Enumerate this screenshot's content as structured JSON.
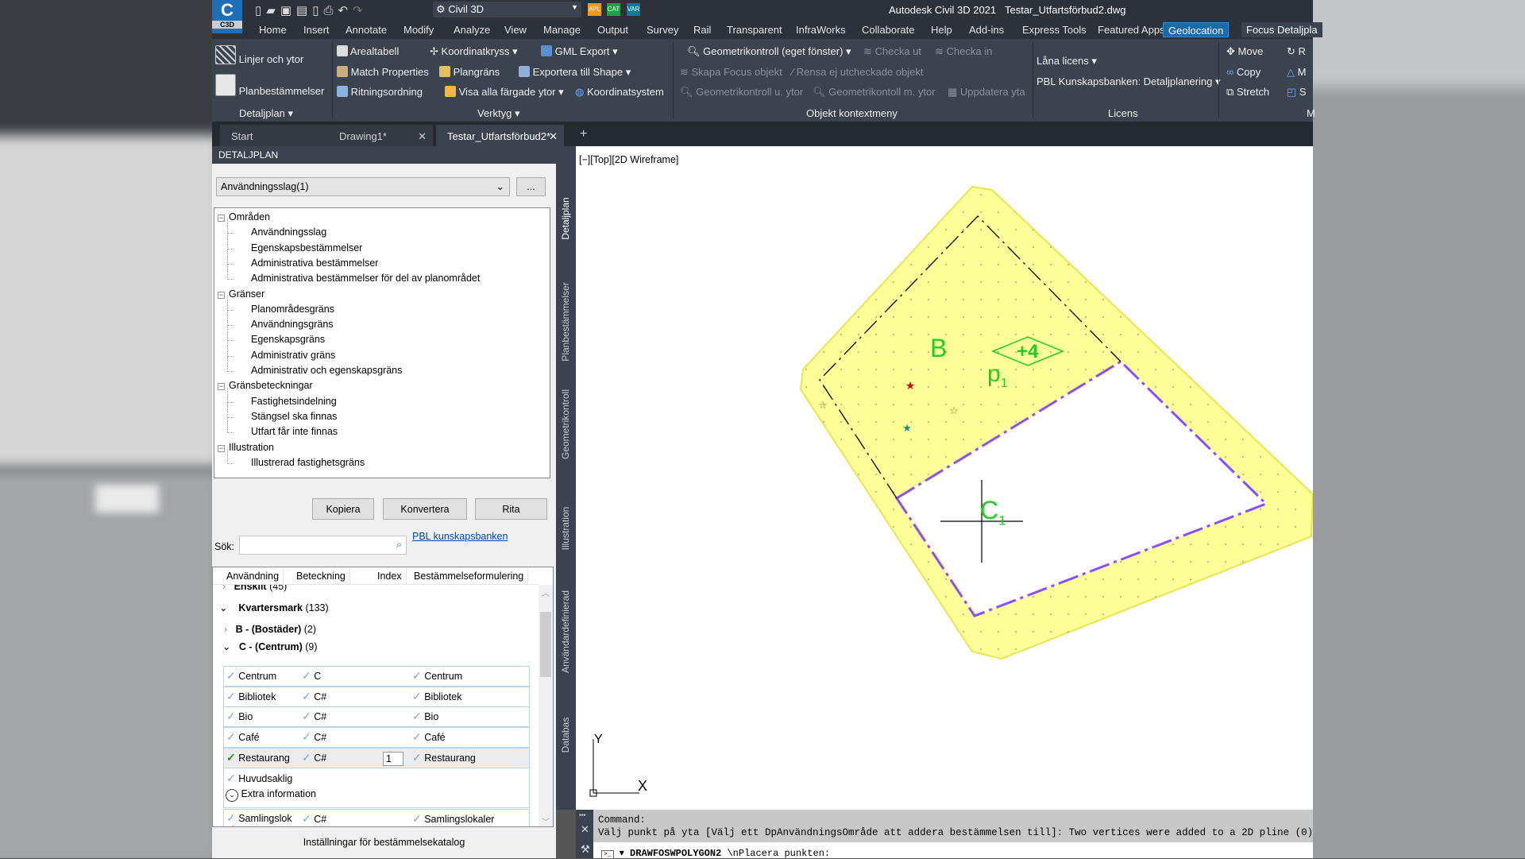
{
  "titlebar": {
    "app_title": "Autodesk Civil 3D 2021",
    "file": "Testar_Utfartsförbud2.dwg",
    "workspace": "Civil 3D",
    "app_badge": "C3D",
    "quick_badges": [
      "APL",
      "CAT",
      "VAR"
    ]
  },
  "menu_tabs": [
    "Home",
    "Insert",
    "Annotate",
    "Modify",
    "Analyze",
    "View",
    "Manage",
    "Output",
    "Survey",
    "Rail",
    "Transparent",
    "InfraWorks",
    "Collaborate",
    "Help",
    "Add-ins",
    "Express Tools",
    "Featured Apps",
    "Geolocation",
    "Focus Detaljpla"
  ],
  "ribbon": {
    "detaljplan": {
      "items": [
        "Linjer och ytor",
        "Planbestämmelser"
      ],
      "label": "Detaljplan"
    },
    "verktyg": {
      "items": [
        "Arealtabell",
        "Koordinatkryss",
        "GML Export",
        "Match Properties",
        "Plangräns",
        "Exportera till Shape",
        "Ritningsordning",
        "Visa alla färgade ytor",
        "Koordinatsystem"
      ],
      "label": "Verktyg"
    },
    "objekt": {
      "items": [
        "Geometrikontroll (eget fönster)",
        "Checka ut",
        "Checka in",
        "Skapa Focus objekt",
        "Rensa ej utcheckade objekt",
        "Geometrikontroll u. ytor",
        "Geometrikontoll m. ytor",
        "Uppdatera yta"
      ],
      "label": "Objekt kontextmeny"
    },
    "licens": {
      "items": [
        "Låna licens",
        "PBL Kunskapsbanken: Detaljplanering"
      ],
      "label": "Licens"
    },
    "modify": {
      "items": [
        "Move",
        "Copy",
        "Stretch",
        "R",
        "M",
        "S"
      ],
      "label": "M"
    }
  },
  "doc_tabs": [
    {
      "label": "Start"
    },
    {
      "label": "Drawing1*"
    },
    {
      "label": "Testar_Utfartsförbud2*"
    }
  ],
  "panel": {
    "header": "DETALJPLAN",
    "dropdown_value": "Användningsslag(1)",
    "more_button": "...",
    "tree": [
      {
        "label": "Områden",
        "children": [
          "Användningsslag",
          "Egenskapsbestämmelser",
          "Administrativa bestämmelser",
          "Administrativa bestämmelser för del av planområdet"
        ]
      },
      {
        "label": "Gränser",
        "children": [
          "Planområdesgräns",
          "Användningsgräns",
          "Egenskapsgräns",
          "Administrativ gräns",
          "Administrativ och egenskapsgräns"
        ]
      },
      {
        "label": "Gränsbeteckningar",
        "children": [
          "Fastighetsindelning",
          "Stängsel ska finnas",
          "Utfart får inte finnas"
        ]
      },
      {
        "label": "Illustration",
        "children": [
          "Illustrerad fastighetsgräns"
        ]
      }
    ],
    "buttons": [
      "Kopiera",
      "Konvertera",
      "Rita"
    ],
    "search_label": "Sök:",
    "search_value": "",
    "pbl_link": "PBL kunskapsbanken",
    "columns": [
      "Användning",
      "Beteckning",
      "Index",
      "Bestämmelseformulering"
    ],
    "groups": {
      "enskilt": "Enskilt",
      "enskilt_count": "(45)",
      "kvarter": "Kvartersmark",
      "kvarter_count": "(133)",
      "b": "B - (Bostäder)",
      "b_count": "(2)",
      "c": "C - (Centrum)",
      "c_count": "(9)"
    },
    "rows": [
      {
        "use": "Centrum",
        "code": "C",
        "index": "",
        "text": "Centrum"
      },
      {
        "use": "Bibliotek",
        "code": "C#",
        "index": "",
        "text": "Bibliotek"
      },
      {
        "use": "Bio",
        "code": "C#",
        "index": "",
        "text": "Bio"
      },
      {
        "use": "Café",
        "code": "C#",
        "index": "",
        "text": "Café"
      },
      {
        "use": "Restaurang",
        "code": "C#",
        "index": "1",
        "text": "Restaurang",
        "selected": true
      }
    ],
    "huvudsaklig": "Huvudsaklig",
    "extra_info": "Extra information",
    "last_row": {
      "use": "Samlingslok aler",
      "code": "C#",
      "text": "Samlingslokaler"
    },
    "footer": "Inställningar för bestämmelsekatalog"
  },
  "side_tabs": [
    "Detaljplan",
    "Planbestämmelser",
    "Geometrikontroll",
    "Illustration",
    "Användardefinierad",
    "Databas"
  ],
  "viewport": {
    "label": "[−][Top][2D Wireframe]",
    "labels": {
      "b": "B",
      "height": "+4",
      "p": "p",
      "p_sub": "1",
      "c": "C",
      "c_sub": "1"
    },
    "ucs": {
      "x": "X",
      "y": "Y"
    },
    "colors": {
      "fill": "#ffff99",
      "text": "#22cc22",
      "border": "#8a4dff"
    }
  },
  "command": {
    "history": [
      "Command:",
      "Välj punkt på yta [Välj ett DpAnvändningsOmråde att addera bestämmelsen till]: Two vertices were added to a 2D pline (0)"
    ],
    "command_name": "DRAWFOSWPOLYGON2",
    "prompt": "\\nPlacera punkten:"
  }
}
